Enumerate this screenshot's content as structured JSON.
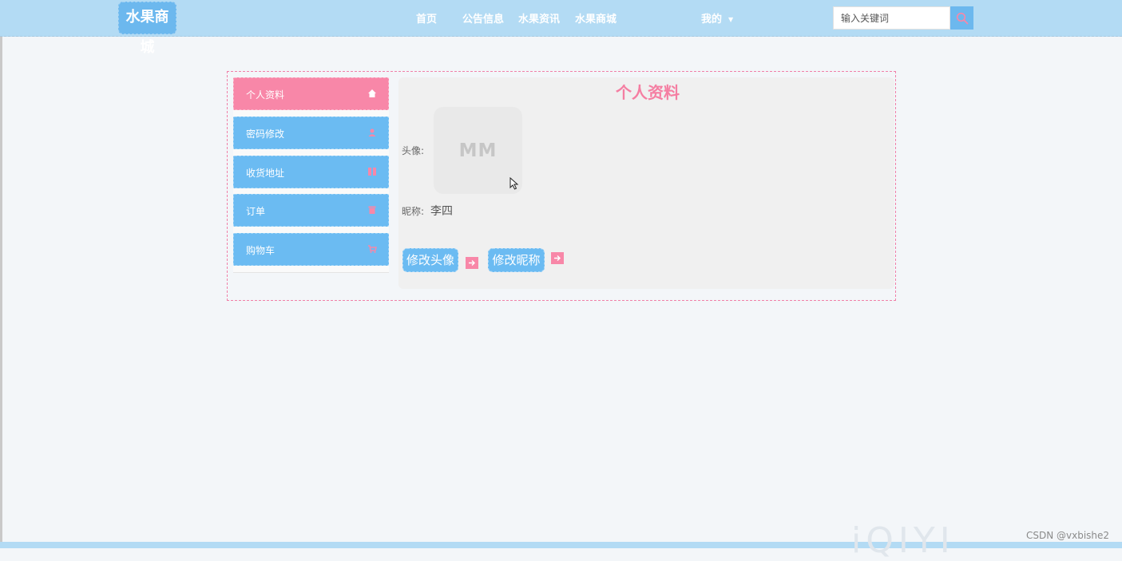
{
  "header": {
    "logo": "水果商城",
    "nav": [
      "首页",
      "公告信息",
      "水果资讯",
      "水果商城"
    ],
    "mine": "我的",
    "search_placeholder": "输入关键词"
  },
  "sidebar": {
    "items": [
      {
        "label": "个人资料",
        "icon": "home-icon",
        "active": true
      },
      {
        "label": "密码修改",
        "icon": "user-icon",
        "active": false
      },
      {
        "label": "收货地址",
        "icon": "columns-icon",
        "active": false
      },
      {
        "label": "订单",
        "icon": "trash-icon",
        "active": false
      },
      {
        "label": "购物车",
        "icon": "cart-icon",
        "active": false
      }
    ]
  },
  "profile": {
    "title": "个人资料",
    "avatar_label": "头像:",
    "avatar_text": "MM",
    "nickname_label": "昵称:",
    "nickname_value": "李四",
    "change_avatar_button": "修改头像",
    "change_nickname_button": "修改昵称"
  },
  "watermarks": {
    "video": "iQIYI",
    "csdn": "CSDN @vxbishe2"
  },
  "colors": {
    "header_bg": "#b3dbf4",
    "accent_blue": "#6bbbf2",
    "accent_pink": "#f887a8",
    "title_pink": "#f57ea2"
  }
}
